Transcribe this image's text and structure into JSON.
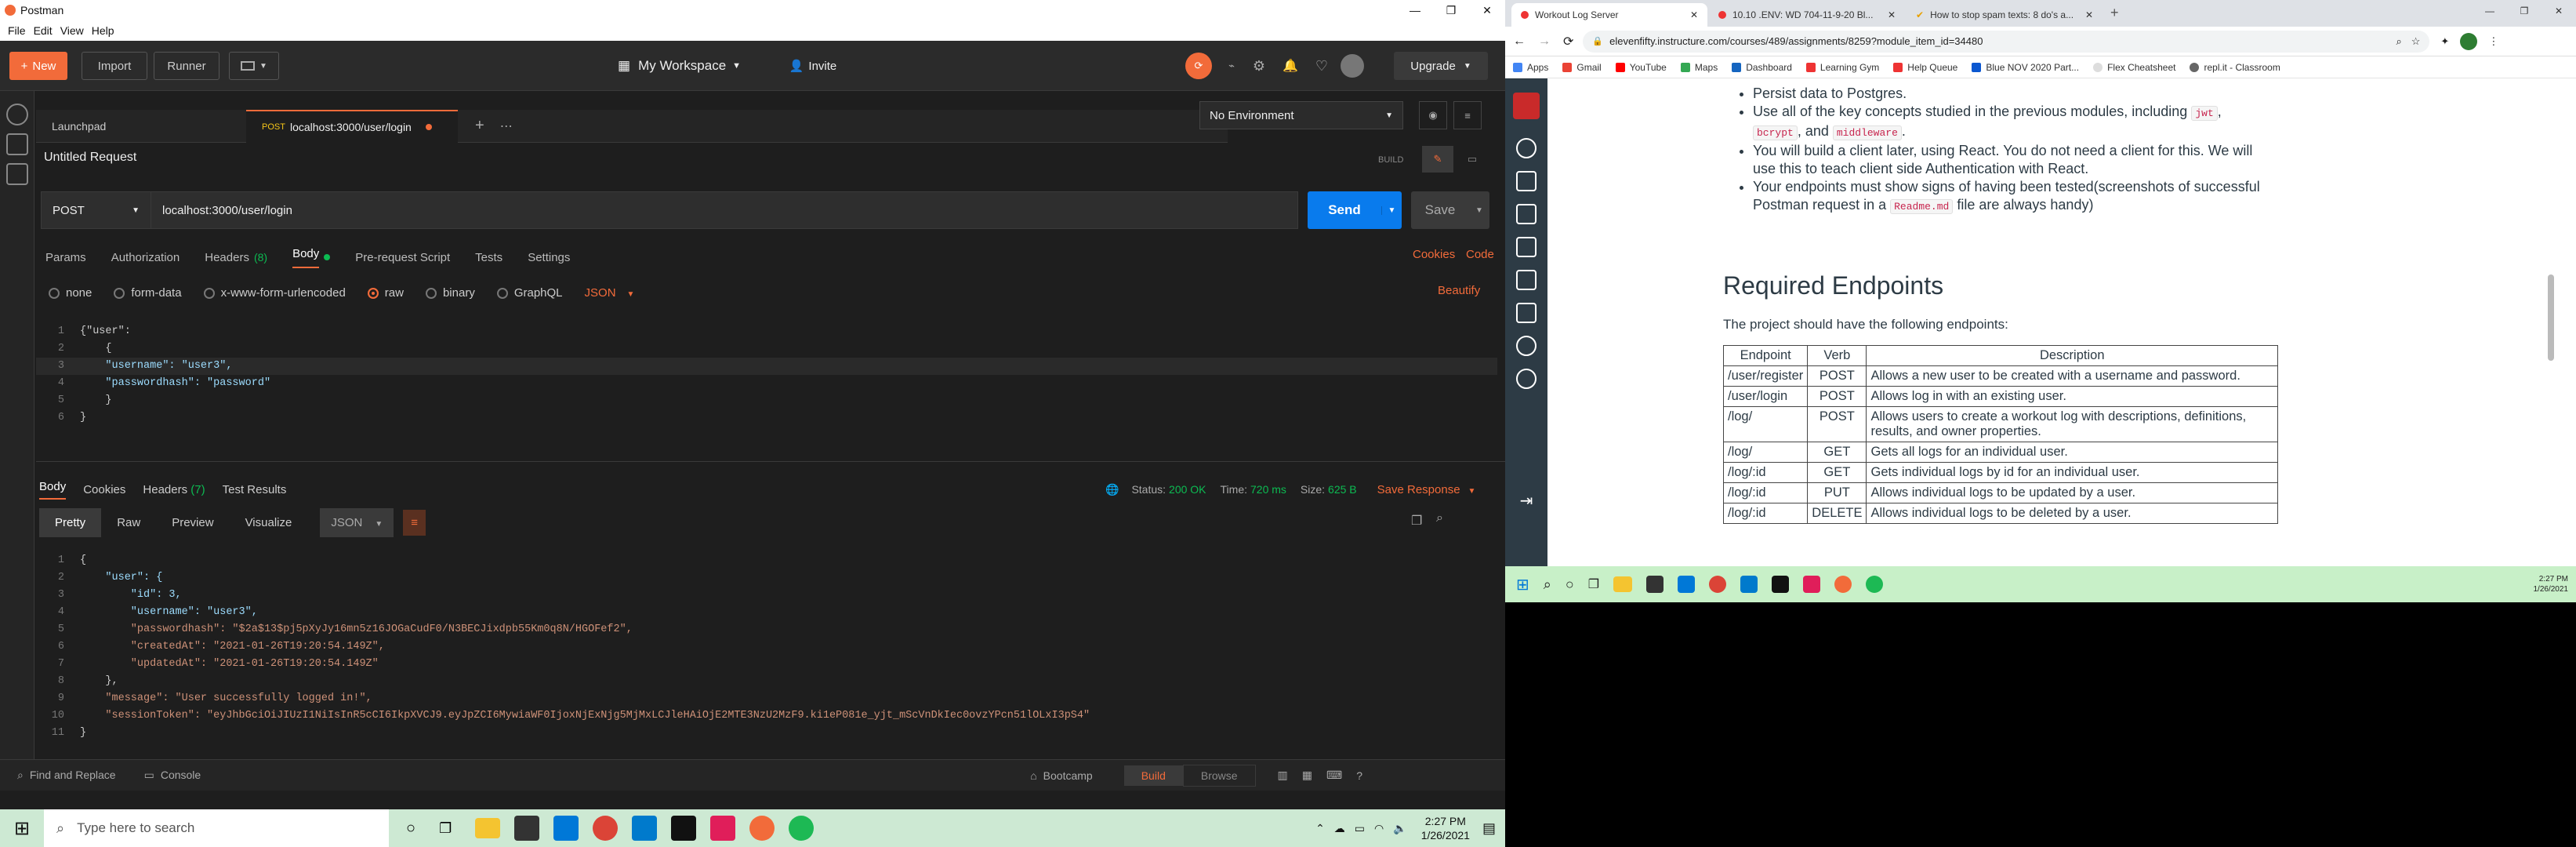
{
  "postman": {
    "window_title": "Postman",
    "menu": [
      "File",
      "Edit",
      "View",
      "Help"
    ],
    "header": {
      "new_label": "New",
      "import_label": "Import",
      "runner_label": "Runner",
      "workspace_label": "My Workspace",
      "invite_label": "Invite",
      "upgrade_label": "Upgrade"
    },
    "tabs": [
      {
        "label": "Launchpad"
      },
      {
        "method": "POST",
        "label": "localhost:3000/user/login"
      }
    ],
    "environment": "No Environment",
    "request": {
      "name": "Untitled Request",
      "build_label": "BUILD",
      "method": "POST",
      "url": "localhost:3000/user/login",
      "send_label": "Send",
      "save_label": "Save",
      "sub_tabs": [
        "Params",
        "Authorization",
        "Headers",
        "Body",
        "Pre-request Script",
        "Tests",
        "Settings"
      ],
      "headers_count": "(8)",
      "cookies_label": "Cookies",
      "code_label": "Code",
      "body_types": [
        "none",
        "form-data",
        "x-www-form-urlencoded",
        "raw",
        "binary",
        "GraphQL"
      ],
      "body_format": "JSON",
      "beautify_label": "Beautify",
      "body_lines": [
        "{\"user\":",
        "    {",
        "    \"username\": \"user3\",",
        "    \"passwordhash\": \"password\"",
        "    }",
        "}"
      ]
    },
    "response": {
      "tabs": [
        "Body",
        "Cookies",
        "Headers",
        "Test Results"
      ],
      "headers_count": "(7)",
      "status_label": "Status:",
      "status": "200 OK",
      "time_label": "Time:",
      "time": "720 ms",
      "size_label": "Size:",
      "size": "625 B",
      "save_response_label": "Save Response",
      "view_modes": [
        "Pretty",
        "Raw",
        "Preview",
        "Visualize"
      ],
      "format": "JSON",
      "lines": [
        "{",
        "    \"user\": {",
        "        \"id\": 3,",
        "        \"username\": \"user3\",",
        "        \"passwordhash\": \"$2a$13$pj5pXyJy16mn5z16JOGaCudF0/N3BECJixdpb55Km0q8N/HGOFef2\",",
        "        \"createdAt\": \"2021-01-26T19:20:54.149Z\",",
        "        \"updatedAt\": \"2021-01-26T19:20:54.149Z\"",
        "    },",
        "    \"message\": \"User successfully logged in!\",",
        "    \"sessionToken\": \"eyJhbGciOiJIUzI1NiIsInR5cCI6IkpXVCJ9.eyJpZCI6MywiaWF0IjoxNjExNjg5MjMxLCJleHAiOjE2MTE3NzU2MzF9.ki1eP081e_yjt_mScVnDkIec0ovzYPcn51lOLxI3pS4\"",
        "}"
      ]
    },
    "footer": {
      "find_replace": "Find and Replace",
      "console": "Console",
      "bootcamp": "Bootcamp",
      "build": "Build",
      "browse": "Browse"
    }
  },
  "browser": {
    "tabs": [
      "Workout Log Server",
      "10.10 .ENV: WD 704-11-9-20 Bl...",
      "How to stop spam texts: 8 do's a..."
    ],
    "url": "elevenfifty.instructure.com/courses/489/assignments/8259?module_item_id=34480",
    "bookmarks": [
      "Apps",
      "Gmail",
      "YouTube",
      "Maps",
      "Dashboard",
      "Learning Gym",
      "Help Queue",
      "Blue NOV 2020 Part...",
      "Flex Cheatsheet",
      "repl.it - Classroom"
    ],
    "bullets": {
      "b1": "Persist data to Postgres.",
      "b2_pre": "Use all of the key concepts studied in the previous modules, including",
      "b2_jwt": "jwt",
      "b2_bcrypt": "bcrypt",
      "b2_and": ", and",
      "b2_mw": "middleware",
      "b3": "You will build a client later, using React. You do not need a client for this. We will use this to teach client side Authentication with React.",
      "b4_pre": "Your endpoints must show signs of having been tested(screenshots of successful Postman request in a",
      "b4_code": "Readme.md",
      "b4_post": "file are always handy)"
    },
    "heading": "Required Endpoints",
    "intro": "The project should have the following endpoints:",
    "table_headers": [
      "Endpoint",
      "Verb",
      "Description"
    ],
    "endpoints": [
      [
        "/user/register",
        "POST",
        "Allows a new user to be created with a username and password."
      ],
      [
        "/user/login",
        "POST",
        "Allows log in with an existing user."
      ],
      [
        "/log/",
        "POST",
        "Allows users to create a workout log with descriptions, definitions, results, and owner properties."
      ],
      [
        "/log/",
        "GET",
        "Gets all logs for an individual user."
      ],
      [
        "/log/:id",
        "GET",
        "Gets individual logs by id for an individual user."
      ],
      [
        "/log/:id",
        "PUT",
        "Allows individual logs to be updated by a user."
      ],
      [
        "/log/:id",
        "DELETE",
        "Allows individual logs to be deleted by a user."
      ]
    ],
    "taskbar_time": "2:27 PM",
    "taskbar_date": "1/26/2021"
  },
  "taskbar": {
    "search_placeholder": "Type here to search",
    "time": "2:27 PM",
    "date": "1/26/2021"
  },
  "colors": {
    "postman_orange": "#f26b3a",
    "send_blue": "#097bed",
    "status_green": "#0cbb52",
    "canvas_nav": "#2d3b45"
  }
}
